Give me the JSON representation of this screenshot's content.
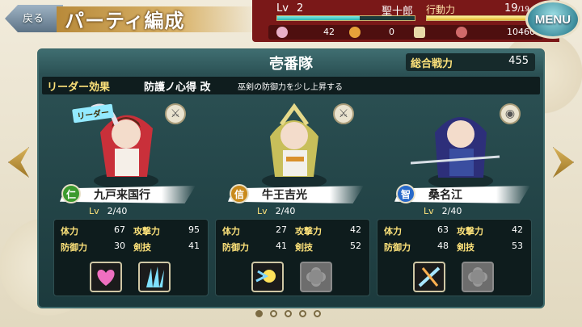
{
  "header": {
    "back_label": "戻る",
    "title": "パーティ編成",
    "menu_label": "MENU"
  },
  "player": {
    "lv_label": "Lv",
    "lv": "2",
    "name": "聖十郎",
    "ap_label": "行動力",
    "ap": "19",
    "ap_max": "/19",
    "exp_fraction": 0.6,
    "ap_fraction": 1.0
  },
  "resources": [
    {
      "icon": "gem-icon",
      "value": "42",
      "color": "#e8b0c8"
    },
    {
      "icon": "coin-icon",
      "value": "0",
      "color": "#e6a23a"
    },
    {
      "icon": "plus-icon",
      "value": "",
      "color": "#e8d9a8"
    },
    {
      "icon": "flower-icon",
      "value": "10460",
      "color": "#d06a6a"
    }
  ],
  "squad": {
    "title": "壱番隊",
    "power_label": "総合戦力",
    "power": "455"
  },
  "leader": {
    "label": "リーダー効果",
    "skill": "防護ノ心得 改",
    "desc": "巫剣の防御力を少し上昇する",
    "tag": "リーダー"
  },
  "characters": [
    {
      "name": "九戸来国行",
      "type": "仁",
      "type_color": "#3c9a2e",
      "lv_label": "Lv",
      "lv": "2/40",
      "hp_label": "体力",
      "hp": "67",
      "atk_label": "攻撃力",
      "atk": "95",
      "def_label": "防御力",
      "def": "30",
      "skill_label": "剣技",
      "skill": "41"
    },
    {
      "name": "牛王吉光",
      "type": "信",
      "type_color": "#c98a1c",
      "lv_label": "Lv",
      "lv": "2/40",
      "hp_label": "体力",
      "hp": "27",
      "atk_label": "攻撃力",
      "atk": "42",
      "def_label": "防御力",
      "def": "41",
      "skill_label": "剣技",
      "skill": "52"
    },
    {
      "name": "桑名江",
      "type": "智",
      "type_color": "#2a6ac9",
      "lv_label": "Lv",
      "lv": "2/40",
      "hp_label": "体力",
      "hp": "63",
      "atk_label": "攻撃力",
      "atk": "42",
      "def_label": "防御力",
      "def": "48",
      "skill_label": "剣技",
      "skill": "53"
    }
  ],
  "pagination": {
    "pages": 5,
    "current": 1
  }
}
